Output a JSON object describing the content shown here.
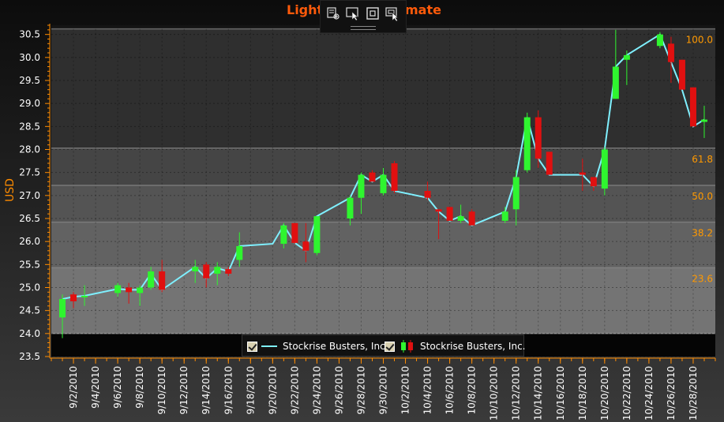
{
  "window": {
    "title_left": "Light",
    "title_right": "mate"
  },
  "toolbar": {
    "buttons": [
      "zoom-select-icon",
      "pointer-select-icon",
      "fit-view-icon",
      "zoom-pointer-icon"
    ]
  },
  "colors": {
    "up": "#2ff52f",
    "down": "#e01010",
    "line": "#7ff0ff",
    "fib_label": "#ff9900",
    "axis_title": "#ff8c00"
  },
  "legend": {
    "items": [
      {
        "label": "Stockrise Busters, Inc.",
        "kind": "line"
      },
      {
        "label": "Stockrise Busters, Inc.",
        "kind": "candles"
      }
    ]
  },
  "chart_data": {
    "type": "candlestick",
    "title": "",
    "xlabel": "",
    "ylabel": "USD",
    "ylim": [
      23.5,
      30.7
    ],
    "yticks": [
      23.5,
      24.0,
      24.5,
      25.0,
      25.5,
      26.0,
      26.5,
      27.0,
      27.5,
      28.0,
      28.5,
      29.0,
      29.5,
      30.0,
      30.5
    ],
    "xlim": [
      "2010-08-31",
      "2010-10-30"
    ],
    "xticks": [
      "9/2/2010",
      "9/4/2010",
      "9/6/2010",
      "9/8/2010",
      "9/10/2010",
      "9/12/2010",
      "9/14/2010",
      "9/16/2010",
      "9/18/2010",
      "9/20/2010",
      "9/22/2010",
      "9/24/2010",
      "9/26/2010",
      "9/28/2010",
      "9/30/2010",
      "10/2/2010",
      "10/4/2010",
      "10/6/2010",
      "10/8/2010",
      "10/10/2010",
      "10/12/2010",
      "10/14/2010",
      "10/16/2010",
      "10/18/2010",
      "10/20/2010",
      "10/22/2010",
      "10/24/2010",
      "10/26/2010",
      "10/28/2010"
    ],
    "fibonacci_levels": [
      {
        "label": "100.0",
        "value": 30.62
      },
      {
        "label": "61.8",
        "value": 28.03
      },
      {
        "label": "50.0",
        "value": 27.22
      },
      {
        "label": "38.2",
        "value": 26.42
      },
      {
        "label": "23.6",
        "value": 25.43
      }
    ],
    "series": [
      {
        "name": "Stockrise Busters, Inc.",
        "kind": "line",
        "points": [
          [
            "2010-09-01",
            24.75
          ],
          [
            "2010-09-02",
            24.8
          ],
          [
            "2010-09-03",
            24.82
          ],
          [
            "2010-09-06",
            24.97
          ],
          [
            "2010-09-07",
            24.95
          ],
          [
            "2010-09-08",
            24.95
          ],
          [
            "2010-09-09",
            25.3
          ],
          [
            "2010-09-10",
            24.95
          ],
          [
            "2010-09-13",
            25.45
          ],
          [
            "2010-09-14",
            25.2
          ],
          [
            "2010-09-15",
            25.42
          ],
          [
            "2010-09-16",
            25.35
          ],
          [
            "2010-09-17",
            25.9
          ],
          [
            "2010-09-20",
            25.95
          ],
          [
            "2010-09-21",
            26.35
          ],
          [
            "2010-09-22",
            25.97
          ],
          [
            "2010-09-23",
            25.8
          ],
          [
            "2010-09-24",
            26.55
          ],
          [
            "2010-09-27",
            26.95
          ],
          [
            "2010-09-28",
            27.45
          ],
          [
            "2010-09-29",
            27.3
          ],
          [
            "2010-09-30",
            27.45
          ],
          [
            "2010-10-01",
            27.1
          ],
          [
            "2010-10-04",
            26.95
          ],
          [
            "2010-10-05",
            26.65
          ],
          [
            "2010-10-06",
            26.45
          ],
          [
            "2010-10-07",
            26.55
          ],
          [
            "2010-10-08",
            26.35
          ],
          [
            "2010-10-11",
            26.65
          ],
          [
            "2010-10-12",
            27.4
          ],
          [
            "2010-10-13",
            28.7
          ],
          [
            "2010-10-14",
            27.8
          ],
          [
            "2010-10-15",
            27.45
          ],
          [
            "2010-10-18",
            27.45
          ],
          [
            "2010-10-19",
            27.2
          ],
          [
            "2010-10-20",
            28.0
          ],
          [
            "2010-10-21",
            29.8
          ],
          [
            "2010-10-22",
            30.05
          ],
          [
            "2010-10-25",
            30.5
          ],
          [
            "2010-10-26",
            29.9
          ],
          [
            "2010-10-27",
            29.3
          ],
          [
            "2010-10-28",
            28.5
          ],
          [
            "2010-10-29",
            28.65
          ]
        ]
      },
      {
        "name": "Stockrise Busters, Inc.",
        "kind": "candlestick",
        "ohlc": [
          [
            "2010-09-01",
            24.35,
            24.85,
            23.9,
            24.75
          ],
          [
            "2010-09-02",
            24.85,
            24.9,
            24.55,
            24.7
          ],
          [
            "2010-09-03",
            24.8,
            25.05,
            24.6,
            24.82
          ],
          [
            "2010-09-06",
            24.88,
            25.1,
            24.8,
            25.05
          ],
          [
            "2010-09-07",
            25.0,
            25.1,
            24.65,
            24.9
          ],
          [
            "2010-09-08",
            24.88,
            25.05,
            24.6,
            25.0
          ],
          [
            "2010-09-09",
            25.0,
            25.45,
            24.95,
            25.35
          ],
          [
            "2010-09-10",
            25.35,
            25.6,
            24.9,
            24.95
          ],
          [
            "2010-09-13",
            25.35,
            25.6,
            25.1,
            25.45
          ],
          [
            "2010-09-14",
            25.5,
            25.55,
            25.0,
            25.2
          ],
          [
            "2010-09-15",
            25.3,
            25.55,
            25.05,
            25.45
          ],
          [
            "2010-09-16",
            25.4,
            25.45,
            25.25,
            25.3
          ],
          [
            "2010-09-17",
            25.6,
            26.2,
            25.45,
            25.9
          ],
          [
            "2010-09-21",
            25.95,
            26.4,
            25.85,
            26.35
          ],
          [
            "2010-09-22",
            26.4,
            26.4,
            25.95,
            25.97
          ],
          [
            "2010-09-23",
            26.0,
            26.4,
            25.55,
            25.8
          ],
          [
            "2010-09-24",
            25.75,
            26.55,
            25.7,
            26.55
          ],
          [
            "2010-09-27",
            26.5,
            27.0,
            26.35,
            26.95
          ],
          [
            "2010-09-28",
            26.95,
            27.5,
            26.6,
            27.45
          ],
          [
            "2010-09-29",
            27.5,
            27.55,
            27.3,
            27.3
          ],
          [
            "2010-09-30",
            27.05,
            27.6,
            27.0,
            27.45
          ],
          [
            "2010-10-01",
            27.7,
            27.75,
            27.05,
            27.1
          ],
          [
            "2010-10-04",
            27.1,
            27.3,
            26.9,
            26.95
          ],
          [
            "2010-10-05",
            26.7,
            26.7,
            26.05,
            26.65
          ],
          [
            "2010-10-06",
            26.75,
            26.75,
            26.45,
            26.45
          ],
          [
            "2010-10-07",
            26.45,
            26.8,
            26.4,
            26.55
          ],
          [
            "2010-10-08",
            26.65,
            26.7,
            26.35,
            26.35
          ],
          [
            "2010-10-11",
            26.45,
            26.75,
            26.4,
            26.65
          ],
          [
            "2010-10-12",
            26.7,
            27.55,
            26.35,
            27.4
          ],
          [
            "2010-10-13",
            27.55,
            28.8,
            27.5,
            28.7
          ],
          [
            "2010-10-14",
            28.7,
            28.85,
            27.6,
            27.8
          ],
          [
            "2010-10-15",
            27.95,
            27.95,
            27.45,
            27.45
          ],
          [
            "2010-10-18",
            27.5,
            27.8,
            27.1,
            27.45
          ],
          [
            "2010-10-19",
            27.4,
            27.4,
            27.1,
            27.2
          ],
          [
            "2010-10-20",
            27.15,
            28.05,
            27.0,
            28.0
          ],
          [
            "2010-10-21",
            29.1,
            30.6,
            29.1,
            29.8
          ],
          [
            "2010-10-22",
            29.95,
            30.15,
            29.4,
            30.05
          ],
          [
            "2010-10-25",
            30.25,
            30.55,
            30.2,
            30.5
          ],
          [
            "2010-10-26",
            30.3,
            30.45,
            29.45,
            29.9
          ],
          [
            "2010-10-27",
            29.95,
            29.95,
            29.3,
            29.3
          ],
          [
            "2010-10-28",
            29.35,
            29.35,
            28.5,
            28.5
          ],
          [
            "2010-10-29",
            28.6,
            28.95,
            28.25,
            28.65
          ]
        ]
      }
    ]
  }
}
